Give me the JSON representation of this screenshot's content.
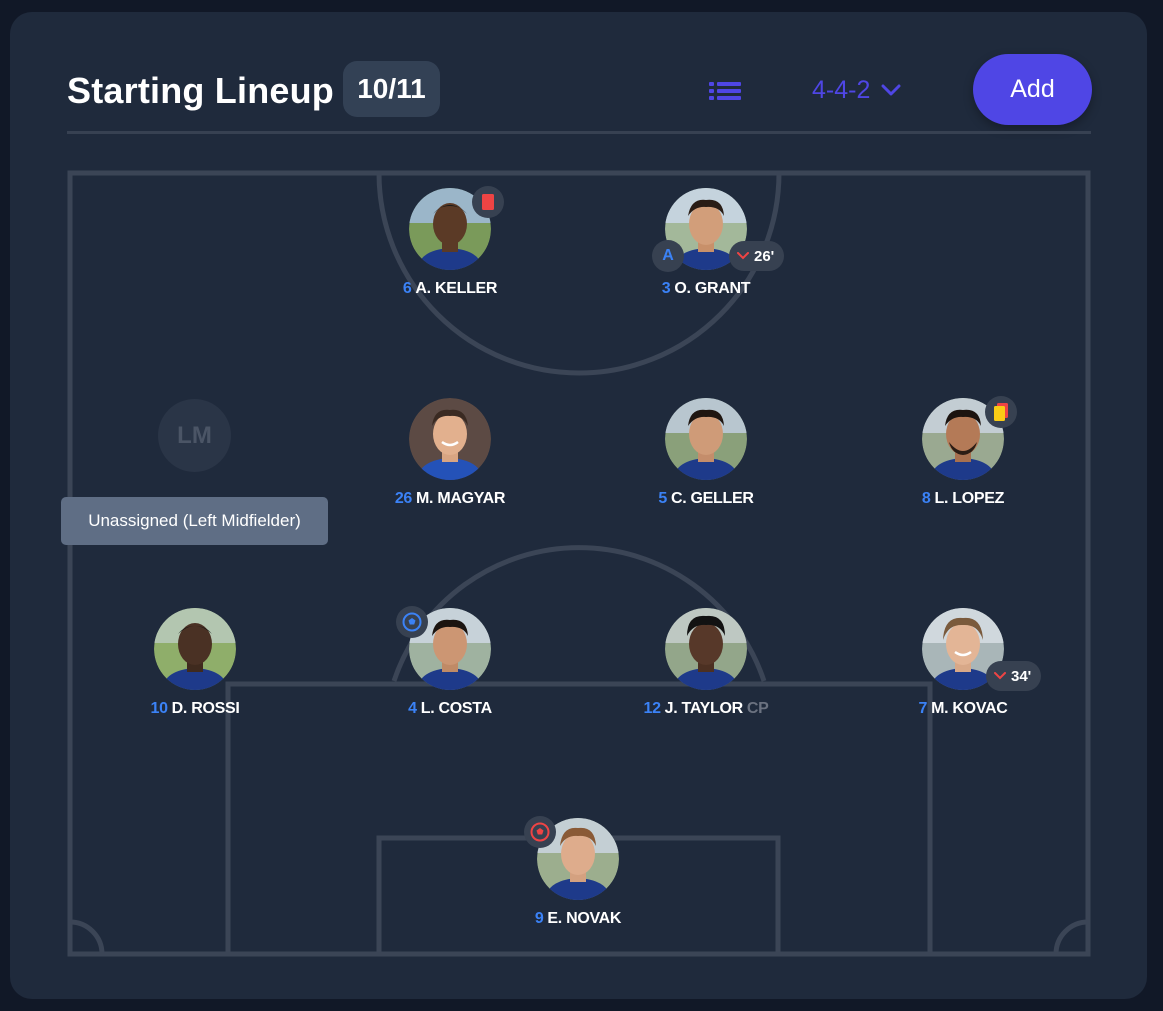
{
  "header": {
    "title": "Starting Lineup",
    "count_badge": "10/11",
    "list_icon": "list-icon",
    "formation": "4-4-2",
    "formation_icon": "chevron-down-icon",
    "add_label": "Add"
  },
  "colors": {
    "accent": "#4f46e5",
    "number": "#3b82f6",
    "card_bg": "#1f2a3c",
    "pitch_lines": "#3b4556",
    "red_card": "#ef4444",
    "yellow_card": "#facc15",
    "sub_off": "#ef4444"
  },
  "players": {
    "keller": {
      "number": "6",
      "name": "A. KELLER",
      "card": "red"
    },
    "grant": {
      "number": "3",
      "name": "O. GRANT",
      "captain": "A",
      "sub_minute": "26'"
    },
    "magyar": {
      "number": "26",
      "name": "M. MAGYAR"
    },
    "geller": {
      "number": "5",
      "name": "C. GELLER"
    },
    "lopez": {
      "number": "8",
      "name": "L. LOPEZ",
      "card": "second-yellow"
    },
    "rossi": {
      "number": "10",
      "name": "D. ROSSI"
    },
    "costa": {
      "number": "4",
      "name": "L. COSTA",
      "goal": "blue"
    },
    "taylor": {
      "number": "12",
      "name": "J. TAYLOR",
      "tag": "CP"
    },
    "kovac": {
      "number": "7",
      "name": "M. KOVAC",
      "sub_minute": "34'"
    },
    "novak": {
      "number": "9",
      "name": "E. NOVAK",
      "goal": "red"
    }
  },
  "empty_slot": {
    "label": "LM",
    "tooltip": "Unassigned (Left Midfielder)"
  }
}
